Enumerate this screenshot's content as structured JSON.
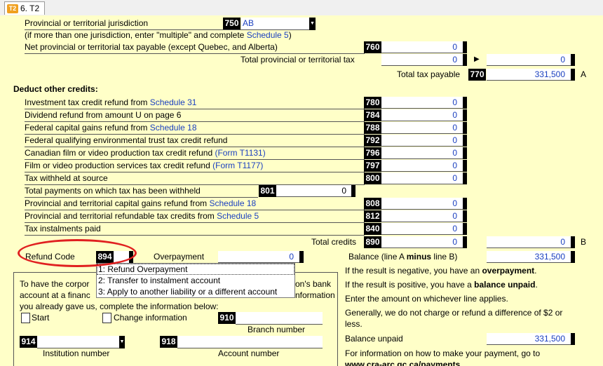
{
  "tab": {
    "icon": "T2",
    "label": "6. T2"
  },
  "top": {
    "jurisdiction_label": "Provincial or territorial jurisdiction",
    "jurisdiction_code": "750",
    "jurisdiction_value": "AB",
    "multiple_note_prefix": "(if more than one jurisdiction, enter \"multiple\" and complete ",
    "multiple_note_link": "Schedule 5",
    "multiple_note_suffix": ")",
    "net_prov_label": "Net provincial or territorial tax payable (except Quebec, and Alberta)",
    "net_prov_code": "760",
    "net_prov_value": "0",
    "total_prov_label": "Total provincial or territorial tax",
    "total_prov_value": "0",
    "total_prov_carry": "0",
    "total_tax_label": "Total tax payable",
    "total_tax_code": "770",
    "total_tax_value": "331,500",
    "total_tax_letter": "A"
  },
  "credits": {
    "heading": "Deduct other credits:",
    "rows": [
      {
        "label": "Investment tax credit refund from ",
        "link": "Schedule 31",
        "code": "780",
        "value": "0"
      },
      {
        "label": "Dividend refund from amount U on page 6",
        "link": "",
        "code": "784",
        "value": "0"
      },
      {
        "label": "Federal capital gains refund from ",
        "link": "Schedule 18",
        "code": "788",
        "value": "0"
      },
      {
        "label": "Federal qualifying environmental trust tax credit refund",
        "link": "",
        "code": "792",
        "value": "0"
      },
      {
        "label": "Canadian film or video production tax credit refund ",
        "link": "(Form T1131)",
        "code": "796",
        "value": "0"
      },
      {
        "label": "Film or video production services tax credit refund ",
        "link": "(Form T1177)",
        "code": "797",
        "value": "0"
      },
      {
        "label": "Tax withheld at source",
        "link": "",
        "code": "800",
        "value": "0"
      }
    ],
    "withheld_label": "Total payments on which tax has been withheld",
    "withheld_code": "801",
    "withheld_value": "0",
    "rows2": [
      {
        "label": "Provincial and territorial capital gains refund from ",
        "link": "Schedule 18",
        "code": "808",
        "value": "0"
      },
      {
        "label": "Provincial and territorial refundable tax credits from ",
        "link": "Schedule 5",
        "code": "812",
        "value": "0"
      },
      {
        "label": "Tax instalments paid",
        "link": "",
        "code": "840",
        "value": "0"
      }
    ],
    "total_label": "Total credits",
    "total_code": "890",
    "total_value": "0",
    "total_carry": "0",
    "total_letter": "B"
  },
  "refund": {
    "label": "Refund Code",
    "code": "894",
    "value": "",
    "overpayment_label": "Overpayment",
    "overpayment_value": "0",
    "options": [
      "1: Refund Overpayment",
      "2: Transfer to instalment account",
      "3: Apply to another liability or a different account"
    ]
  },
  "balance": {
    "label_prefix": "Balance (line A ",
    "label_bold": "minus",
    "label_suffix": " line B)",
    "value": "331,500",
    "neg_prefix": "If the result is negative, you have an ",
    "neg_bold": "overpayment",
    "neg_suffix": ".",
    "pos_prefix": "If the result is positive, you have a ",
    "pos_bold": "balance unpaid",
    "pos_suffix": ".",
    "enter_text": "Enter the amount on whichever line applies.",
    "generally_text1": "Generally, we do not charge or refund a difference of $2 or",
    "generally_text2": "less.",
    "unpaid_label": "Balance unpaid",
    "unpaid_value": "331,500",
    "info_text": "For information on how to make your payment, go to",
    "info_url": "www.cra-arc.gc.ca/payments"
  },
  "deposit": {
    "line1_a": "To have the corpor",
    "line1_b": "on's bank",
    "line2_a": "account at a financ",
    "line2_b": "nformation",
    "line3": "you already gave us, complete the information below:",
    "start_label": "Start",
    "change_label": "Change information",
    "branch_code": "910",
    "branch_label": "Branch number",
    "institution_code": "914",
    "institution_label": "Institution number",
    "account_code": "918",
    "account_label": "Account number"
  }
}
